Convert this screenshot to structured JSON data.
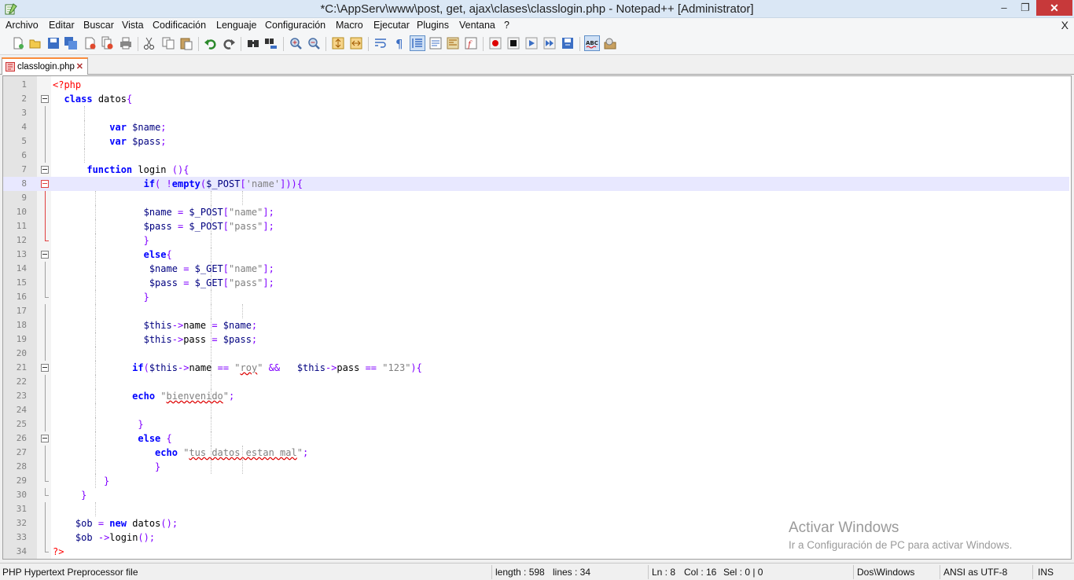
{
  "window": {
    "title": "*C:\\AppServ\\www\\post, get, ajax\\clases\\classlogin.php - Notepad++ [Administrator]",
    "controls": {
      "minimize": "–",
      "maximize": "❐",
      "close": "✕"
    }
  },
  "menubar": {
    "items": [
      "Archivo",
      "Editar",
      "Buscar",
      "Vista",
      "Codificación",
      "Lenguaje",
      "Configuración",
      "Macro",
      "Ejecutar",
      "Plugins",
      "Ventana",
      "?"
    ],
    "close_doc": "X"
  },
  "toolbar": {
    "icons": [
      "new-file-icon",
      "open-file-icon",
      "save-icon",
      "save-all-icon",
      "close-icon",
      "close-all-icon",
      "print-icon",
      "cut-icon",
      "copy-icon",
      "paste-icon",
      "undo-icon",
      "redo-icon",
      "find-icon",
      "replace-icon",
      "zoom-in-icon",
      "zoom-out-icon",
      "sync-vertical-icon",
      "sync-horizontal-icon",
      "word-wrap-icon",
      "show-all-chars-icon",
      "indent-guide-icon",
      "user-language-icon",
      "document-map-icon",
      "function-list-icon",
      "record-macro-icon",
      "stop-record-icon",
      "play-macro-icon",
      "run-macro-multiple-icon",
      "save-macro-icon",
      "spell-check-icon",
      "spell-check-settings-icon"
    ]
  },
  "tab": {
    "label": "classlogin.php",
    "close": "✕"
  },
  "editor": {
    "current_line": 8,
    "lines": [
      {
        "n": "1",
        "text": "<?php"
      },
      {
        "n": "2",
        "text": "  class datos{"
      },
      {
        "n": "3",
        "text": ""
      },
      {
        "n": "4",
        "text": "          var $name;"
      },
      {
        "n": "5",
        "text": "          var $pass;"
      },
      {
        "n": "6",
        "text": ""
      },
      {
        "n": "7",
        "text": "      function login (){"
      },
      {
        "n": "8",
        "text": "                if( !empty($_POST['name'])){"
      },
      {
        "n": "9",
        "text": ""
      },
      {
        "n": "10",
        "text": "                $name = $_POST[\"name\"];"
      },
      {
        "n": "11",
        "text": "                $pass = $_POST[\"pass\"];"
      },
      {
        "n": "12",
        "text": "                }"
      },
      {
        "n": "13",
        "text": "                else{"
      },
      {
        "n": "14",
        "text": "                 $name = $_GET[\"name\"];"
      },
      {
        "n": "15",
        "text": "                 $pass = $_GET[\"pass\"];"
      },
      {
        "n": "16",
        "text": "                }"
      },
      {
        "n": "17",
        "text": ""
      },
      {
        "n": "18",
        "text": "                $this->name = $name;"
      },
      {
        "n": "19",
        "text": "                $this->pass = $pass;"
      },
      {
        "n": "20",
        "text": ""
      },
      {
        "n": "21",
        "text": "              if($this->name == \"roy\" &&   $this->pass == \"123\"){"
      },
      {
        "n": "22",
        "text": ""
      },
      {
        "n": "23",
        "text": "              echo \"bienvenido\";"
      },
      {
        "n": "24",
        "text": ""
      },
      {
        "n": "25",
        "text": "               }"
      },
      {
        "n": "26",
        "text": "               else {"
      },
      {
        "n": "27",
        "text": "                  echo \"tus datos estan mal\";"
      },
      {
        "n": "28",
        "text": "                  }"
      },
      {
        "n": "29",
        "text": "         }"
      },
      {
        "n": "30",
        "text": "     }"
      },
      {
        "n": "31",
        "text": ""
      },
      {
        "n": "32",
        "text": "    $ob = new datos();"
      },
      {
        "n": "33",
        "text": "    $ob ->login();"
      },
      {
        "n": "34",
        "text": "?>"
      }
    ]
  },
  "watermark": {
    "line1": "Activar Windows",
    "line2": "Ir a Configuración de PC para activar Windows."
  },
  "status": {
    "filetype": "PHP Hypertext Preprocessor file",
    "length": "length : 598",
    "lines": "lines : 34",
    "ln": "Ln : 8",
    "col": "Col : 16",
    "sel": "Sel : 0 | 0",
    "eol": "Dos\\Windows",
    "encoding": "ANSI as UTF-8",
    "mode": "INS"
  },
  "colors": {
    "keyword": "#0000ff",
    "variable": "#000080",
    "string": "#808080",
    "php_tag": "#ff0000",
    "current_line": "#e8e8ff",
    "tab_accent": "#fa8c3c"
  }
}
